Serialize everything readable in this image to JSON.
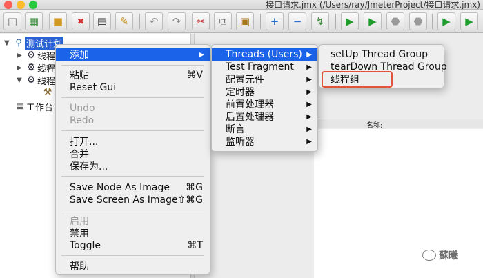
{
  "window": {
    "title": "接口请求.jmx (/Users/ray/JmeterProject/接口请求.jmx)",
    "traffic_colors": {
      "close": "#fc5f57",
      "minimize": "#fdbc2e",
      "zoom": "#28c840"
    }
  },
  "toolbar": {
    "buttons": [
      {
        "name": "new-icon",
        "glyph": "🗋"
      },
      {
        "name": "templates-icon",
        "glyph": "▦"
      },
      {
        "name": "open-icon",
        "glyph": "📂"
      },
      {
        "name": "close-file-icon",
        "glyph": "✖"
      },
      {
        "name": "save-icon",
        "glyph": "💾"
      },
      {
        "name": "save-as-icon",
        "glyph": "✎"
      },
      {
        "name": "undo-icon",
        "glyph": "↶"
      },
      {
        "name": "redo-icon",
        "glyph": "↷"
      },
      {
        "name": "cut-icon",
        "glyph": "✂"
      },
      {
        "name": "copy-icon",
        "glyph": "⧉"
      },
      {
        "name": "paste-icon",
        "glyph": "📋"
      },
      {
        "name": "expand-icon",
        "glyph": "+"
      },
      {
        "name": "collapse-icon",
        "glyph": "−"
      },
      {
        "name": "toggle-icon",
        "glyph": "↯"
      },
      {
        "name": "start-icon",
        "glyph": "▶"
      },
      {
        "name": "start-no-pause-icon",
        "glyph": "▶"
      },
      {
        "name": "stop-icon",
        "glyph": "⛔"
      },
      {
        "name": "shutdown-icon",
        "glyph": "⛔"
      },
      {
        "name": "remote-start-icon",
        "glyph": "▶"
      },
      {
        "name": "remote-start-all-icon",
        "glyph": "▶"
      }
    ]
  },
  "tree": {
    "root": "测试计划",
    "children": [
      "线程",
      "线程",
      "线程"
    ],
    "workbench": "工作台"
  },
  "context_menu": {
    "items": [
      {
        "label": "添加",
        "shortcut": "",
        "submenu": true,
        "highlighted": true,
        "disabled": false
      },
      {
        "label": "粘贴",
        "shortcut": "⌘V",
        "submenu": false,
        "highlighted": false,
        "disabled": false
      },
      {
        "label": "Reset Gui",
        "shortcut": "",
        "submenu": false,
        "highlighted": false,
        "disabled": false
      },
      {
        "label": "Undo",
        "shortcut": "",
        "submenu": false,
        "highlighted": false,
        "disabled": true
      },
      {
        "label": "Redo",
        "shortcut": "",
        "submenu": false,
        "highlighted": false,
        "disabled": true
      },
      {
        "label": "打开...",
        "shortcut": "",
        "submenu": false,
        "highlighted": false,
        "disabled": false
      },
      {
        "label": "合并",
        "shortcut": "",
        "submenu": false,
        "highlighted": false,
        "disabled": false
      },
      {
        "label": "保存为...",
        "shortcut": "",
        "submenu": false,
        "highlighted": false,
        "disabled": false
      },
      {
        "label": "Save Node As Image",
        "shortcut": "⌘G",
        "submenu": false,
        "highlighted": false,
        "disabled": false
      },
      {
        "label": "Save Screen As Image",
        "shortcut": "⇧⌘G",
        "submenu": false,
        "highlighted": false,
        "disabled": false
      },
      {
        "label": "启用",
        "shortcut": "",
        "submenu": false,
        "highlighted": false,
        "disabled": true
      },
      {
        "label": "禁用",
        "shortcut": "",
        "submenu": false,
        "highlighted": false,
        "disabled": false
      },
      {
        "label": "Toggle",
        "shortcut": "⌘T",
        "submenu": false,
        "highlighted": false,
        "disabled": false
      },
      {
        "label": "帮助",
        "shortcut": "",
        "submenu": false,
        "highlighted": false,
        "disabled": false
      }
    ]
  },
  "add_submenu": {
    "items": [
      {
        "label": "Threads (Users)",
        "highlighted": true
      },
      {
        "label": "Test Fragment",
        "highlighted": false
      },
      {
        "label": "配置元件",
        "highlighted": false
      },
      {
        "label": "定时器",
        "highlighted": false
      },
      {
        "label": "前置处理器",
        "highlighted": false
      },
      {
        "label": "后置处理器",
        "highlighted": false
      },
      {
        "label": "断言",
        "highlighted": false
      },
      {
        "label": "监听器",
        "highlighted": false
      }
    ]
  },
  "threads_submenu": {
    "items": [
      {
        "label": "setUp Thread Group",
        "outlined": false
      },
      {
        "label": "tearDown Thread Group",
        "outlined": false
      },
      {
        "label": "线程组",
        "outlined": true
      }
    ],
    "outline_color": "#e2553a"
  },
  "table": {
    "header": "名称:"
  },
  "watermark": {
    "text": "蘇曦"
  }
}
